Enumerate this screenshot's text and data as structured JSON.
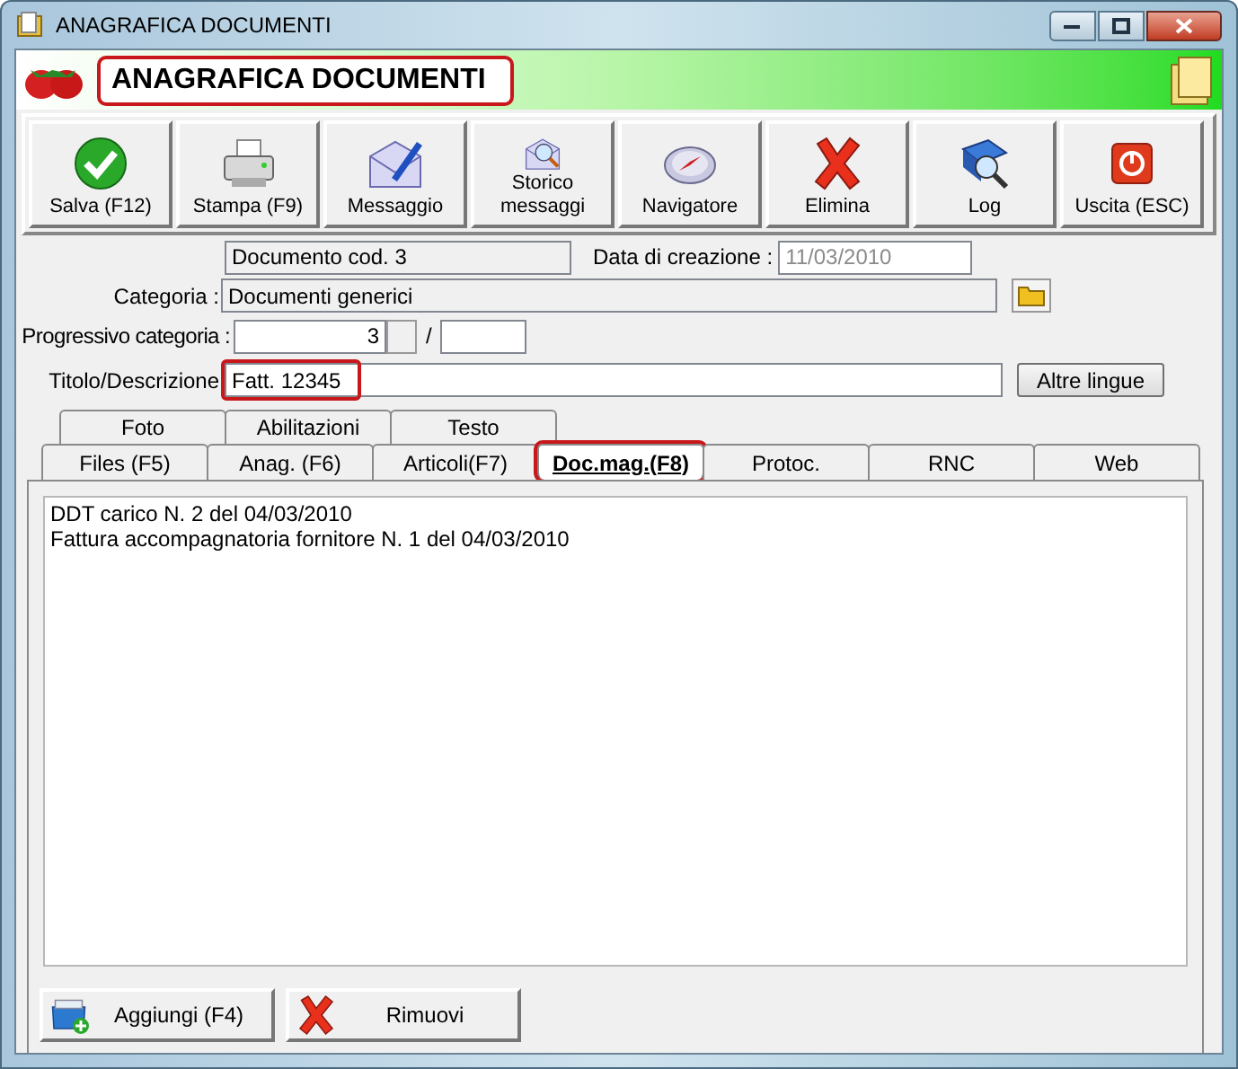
{
  "window": {
    "title": "ANAGRAFICA DOCUMENTI"
  },
  "header": {
    "title": "ANAGRAFICA DOCUMENTI",
    "highlighted": true
  },
  "toolbar": [
    {
      "label": "Salva (F12)",
      "kind": "save"
    },
    {
      "label": "Stampa (F9)",
      "kind": "print"
    },
    {
      "label": "Messaggio",
      "kind": "message"
    },
    {
      "label": "Storico messaggi",
      "kind": "history"
    },
    {
      "label": "Navigatore",
      "kind": "compass"
    },
    {
      "label": "Elimina",
      "kind": "delete"
    },
    {
      "label": "Log",
      "kind": "log"
    },
    {
      "label": "Uscita (ESC)",
      "kind": "exit"
    }
  ],
  "form": {
    "code": {
      "value": "Documento cod. 3",
      "read_only": true
    },
    "created": {
      "label": "Data di creazione :",
      "value": "11/03/2010",
      "disabled": true
    },
    "category": {
      "label": "Categoria :",
      "value": "Documenti generici",
      "read_only": true
    },
    "progressive": {
      "label": "Progressivo categoria :",
      "value": "3",
      "separator": "/"
    },
    "title": {
      "label": "Titolo/Descrizione",
      "value": "Fatt. 12345",
      "highlighted": true
    },
    "other_languages_button": "Altre lingue"
  },
  "tabs_back": [
    {
      "label": "Foto",
      "selected": false
    },
    {
      "label": "Abilitazioni",
      "selected": false
    },
    {
      "label": "Testo",
      "selected": false
    }
  ],
  "tabs_front": [
    {
      "label": "Files (F5)",
      "selected": false,
      "highlighted": false
    },
    {
      "label": "Anag. (F6)",
      "selected": false,
      "highlighted": false
    },
    {
      "label": "Articoli(F7)",
      "selected": false,
      "highlighted": false
    },
    {
      "label": "Doc.mag.(F8)",
      "selected": true,
      "highlighted": true
    },
    {
      "label": "Protoc.",
      "selected": false,
      "highlighted": false
    },
    {
      "label": "RNC",
      "selected": false,
      "highlighted": false
    },
    {
      "label": "Web",
      "selected": false,
      "highlighted": false
    }
  ],
  "list": {
    "items": [
      "DDT carico N. 2 del 04/03/2010",
      "Fattura accompagnatoria fornitore N. 1 del 04/03/2010"
    ]
  },
  "buttons": [
    {
      "label": "Aggiungi (F4)",
      "kind": "add"
    },
    {
      "label": "Rimuovi",
      "kind": "remove"
    }
  ]
}
